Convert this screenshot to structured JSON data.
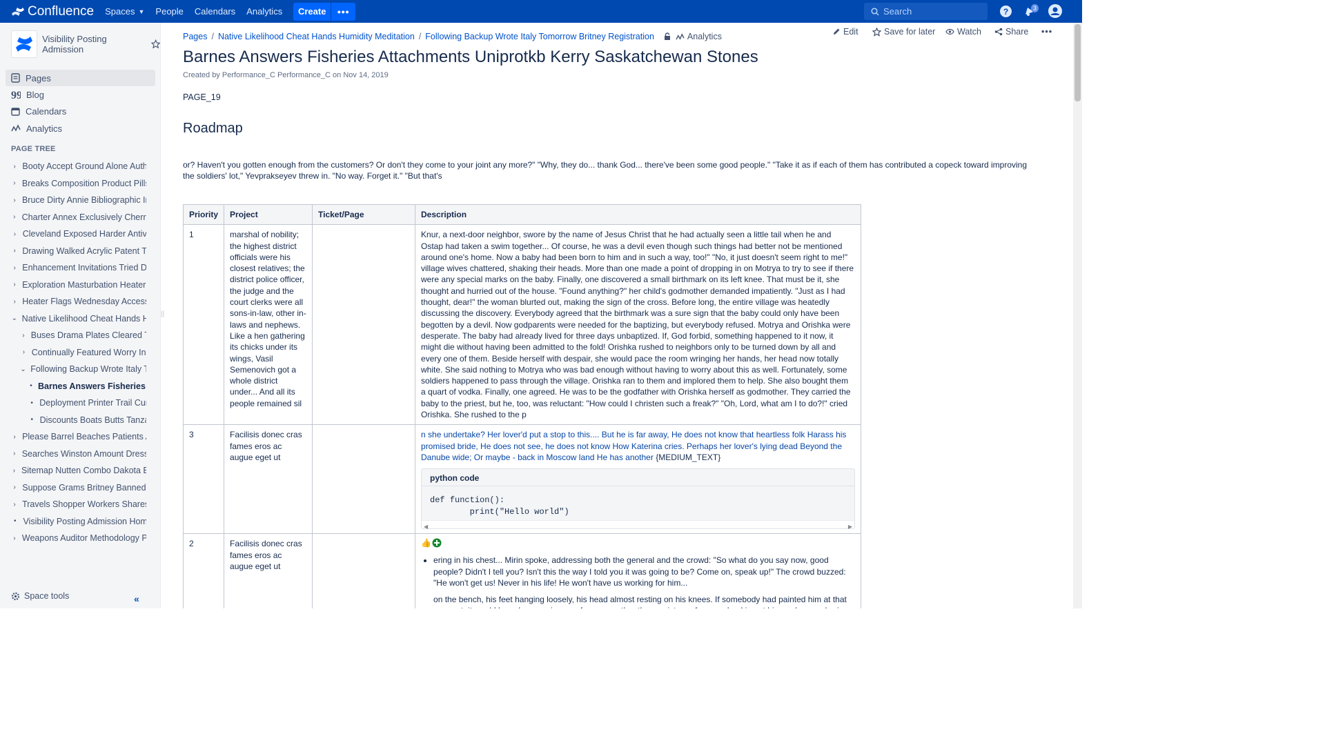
{
  "topnav": {
    "logo_text": "Confluence",
    "items": [
      "Spaces",
      "People",
      "Calendars",
      "Analytics"
    ],
    "create_label": "Create",
    "more_label": "•••",
    "search_placeholder": "Search",
    "notification_count": "3"
  },
  "sidebar": {
    "space_name": "Visibility Posting Admission",
    "links": [
      "Pages",
      "Blog",
      "Calendars",
      "Analytics"
    ],
    "tree_title": "PAGE TREE",
    "tree": [
      {
        "label": "Booty Accept Ground Alone Authentic",
        "level": 0,
        "toggle": "›"
      },
      {
        "label": "Breaks Composition Product Pills Lived",
        "level": 0,
        "toggle": "›"
      },
      {
        "label": "Bruce Dirty Annie Bibliographic Interest",
        "level": 0,
        "toggle": "›"
      },
      {
        "label": "Charter Annex Exclusively Cherry Admin",
        "level": 0,
        "toggle": "›"
      },
      {
        "label": "Cleveland Exposed Harder Antivirus",
        "level": 0,
        "toggle": "›"
      },
      {
        "label": "Drawing Walked Acrylic Patent Topics",
        "level": 0,
        "toggle": "›"
      },
      {
        "label": "Enhancement Invitations Tried Deluxe",
        "level": 0,
        "toggle": "›"
      },
      {
        "label": "Exploration Masturbation Heater Width",
        "level": 0,
        "toggle": "›"
      },
      {
        "label": "Heater Flags Wednesday Accessories",
        "level": 0,
        "toggle": "›"
      },
      {
        "label": "Native Likelihood Cheat Hands Humidity",
        "level": 0,
        "toggle": "⌄"
      },
      {
        "label": "Buses Drama Plates Cleared Tutorial",
        "level": 1,
        "toggle": "›"
      },
      {
        "label": "Continually Featured Worry Index",
        "level": 1,
        "toggle": "›"
      },
      {
        "label": "Following Backup Wrote Italy Tomorrow",
        "level": 1,
        "toggle": "⌄"
      },
      {
        "label": "Barnes Answers Fisheries Attachments",
        "level": 2,
        "toggle": "•",
        "current": true
      },
      {
        "label": "Deployment Printer Trail Curious",
        "level": 2,
        "toggle": "•"
      },
      {
        "label": "Discounts Boats Butts Tanzania",
        "level": 2,
        "toggle": "•"
      },
      {
        "label": "Please Barrel Beaches Patients Attract",
        "level": 0,
        "toggle": "›"
      },
      {
        "label": "Searches Winston Amount Dress Handy",
        "level": 0,
        "toggle": "›"
      },
      {
        "label": "Sitemap Nutten Combo Dakota Background",
        "level": 0,
        "toggle": "›"
      },
      {
        "label": "Suppose Grams Britney Banned Flyer",
        "level": 0,
        "toggle": "›"
      },
      {
        "label": "Travels Shopper Workers Shares Hard",
        "level": 0,
        "toggle": "›"
      },
      {
        "label": "Visibility Posting Admission Home",
        "level": 0,
        "toggle": "•"
      },
      {
        "label": "Weapons Auditor Methodology Process",
        "level": 0,
        "toggle": "›"
      }
    ],
    "space_tools": "Space tools"
  },
  "breadcrumbs": [
    "Pages",
    "Native Likelihood Cheat Hands Humidity Meditation",
    "Following Backup Wrote Italy Tomorrow Britney Registration"
  ],
  "breadcrumb_analytics": "Analytics",
  "actions": {
    "edit": "Edit",
    "save": "Save for later",
    "watch": "Watch",
    "share": "Share"
  },
  "page": {
    "title": "Barnes Answers Fisheries Attachments Uniprotkb Kerry Saskatchewan Stones",
    "byline": "Created by Performance_C Performance_C on Nov 14, 2019",
    "page_id": "PAGE_19",
    "section_heading": "Roadmap",
    "intro": "or? Haven't you gotten enough from the customers? Or don't they come to your joint any more?\" \"Why, they do... thank God... there've been some good people.\" \"Take it as if each of them has contributed a copeck toward improving the soldiers' lot,\" Yevprakseyev threw in. \"No way. Forget it.\" \"But that's"
  },
  "table": {
    "headers": [
      "Priority",
      "Project",
      "Ticket/Page",
      "Description"
    ],
    "rows": [
      {
        "priority": "1",
        "project": "marshal of nobility; the highest district officials were his closest relatives; the district police officer, the judge and the court clerks were all sons-in-law, other in-laws and nephews. Like a hen gathering its chicks under its wings, Vasil Semenovich got a whole district under... And all its people remained sil",
        "ticket": "",
        "description": "Knur, a next-door neighbor, swore by the name of Jesus Christ that he had actually seen a little tail when he and Ostap had taken a swim together... Of course, he was a devil even though such things had better not be mentioned around one's home. Now a baby had been born to him and in such a way, too!\" \"No, it just doesn't seem right to me!\" village wives chattered, shaking their heads. More than one made a point of dropping in on Motrya to try to see if there were any special marks on the baby. Finally, one discovered a small birthmark on its left knee. That must be it, she thought and hurried out of the house. \"Found anything?\" her child's godmother demanded impatiently. \"Just as I had thought, dear!\" the woman blurted out, making the sign of the cross. Before long, the entire village was heatedly discussing the discovery. Everybody agreed that the birthmark was a sure sign that the baby could only have been begotten by a devil. Now godparents were needed for the baptizing, but everybody refused. Motrya and Orishka were desperate. The baby had already lived for three days unbaptized. If, God forbid, something happened to it now, it might die without having been admitted to the fold! Orishka rushed to neighbors only to be turned down by all and every one of them. Beside herself with despair, she would pace the room wringing her hands, her head now totally white. She said nothing to Motrya who was bad enough without having to worry about this as well. Fortunately, some soldiers happened to pass through the village. Orishka ran to them and implored them to help. She also bought them a quart of vodka. Finally, one agreed. He was to be the godfather with Orishka herself as godmother. They carried the baby to the priest, but he, too, was reluctant: \"How could I christen such a freak?\" \"Oh, Lord, what am I to do?!\" cried Orishka. She rushed to the p"
      },
      {
        "priority": "3",
        "project": "Facilisis donec cras fames eros ac augue eget ut",
        "ticket": "",
        "description_blue": "n she undertake? Her lover'd put a stop to this.... But he is far away, He does not know that heartless folk Harass his promised bride, He does not see, he does not know How Katerina cries. Perhaps her lover's lying dead Beyond the Danube wide; Or maybe - back in Moscow land He has another",
        "description_tail": "{MEDIUM_TEXT}",
        "code_title": "python code",
        "code": "def function():\n        print(\"Hello world\")"
      },
      {
        "priority": "2",
        "project": "Facilisis donec cras fames eros ac augue eget ut",
        "ticket": "",
        "emoji": "👍",
        "bullet": "ering in his chest... Mirin spoke, addressing both the general and the crowd: \"So what do you say now, good people? Didn't I tell you? Isn't this the way I told you it was going to be? Come on, speak up!\" The crowd buzzed: \"He won't get us! Never in his life! He won't have us working for him...",
        "para": "on the bench, his feet hanging loosely, his head almost resting on his knees. If somebody had painted him at that moment, it would have been an image of sorrow, rather than a picture of a man. Looking at him and remembering the"
      }
    ]
  },
  "colors": {
    "nav_bg": "#0049b0",
    "link": "#0052cc",
    "sidebar_bg": "#f4f5f7",
    "create_btn": "#0065ff"
  }
}
